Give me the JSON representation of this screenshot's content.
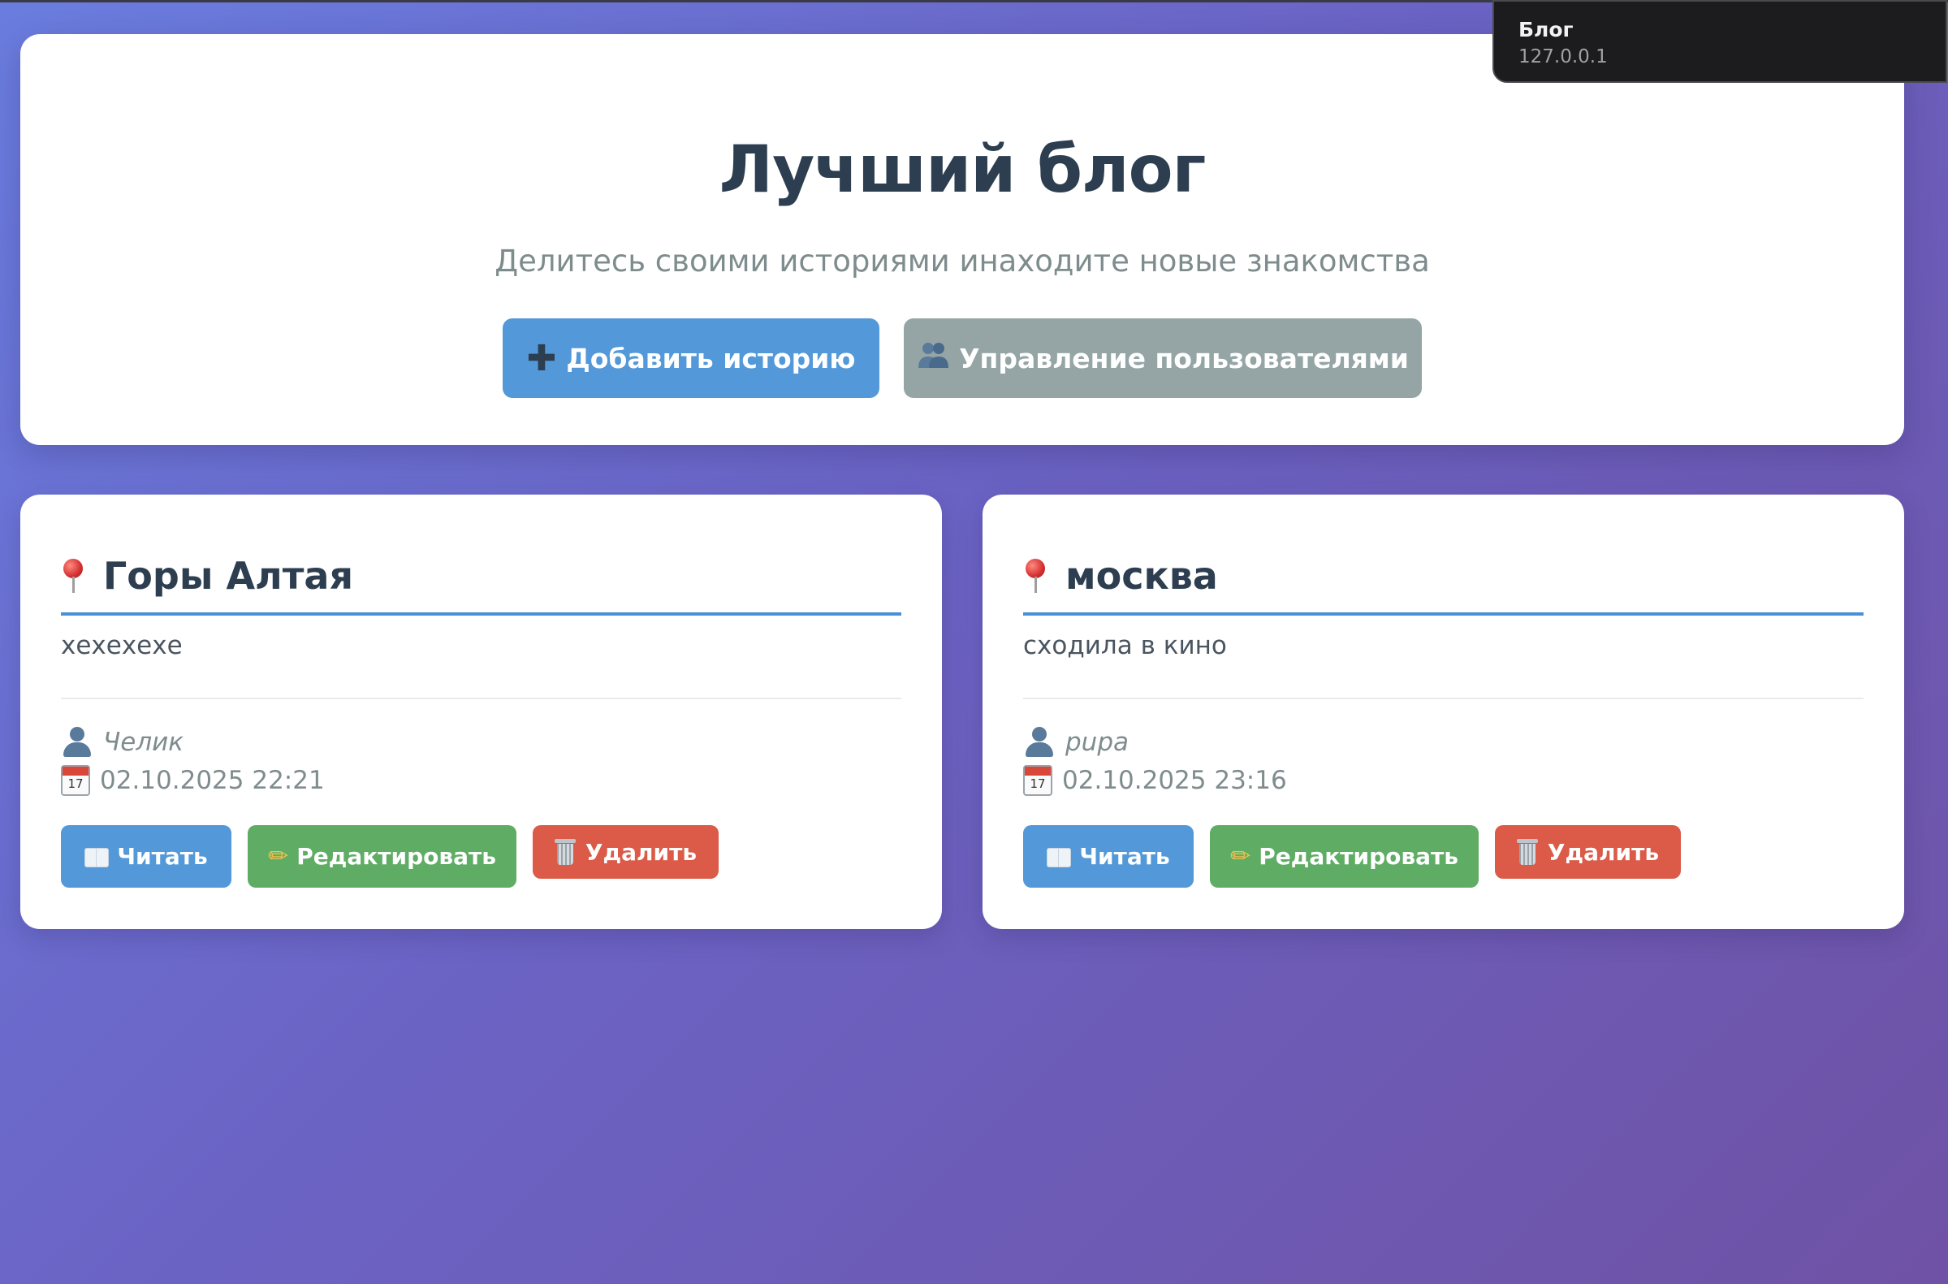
{
  "header": {
    "title": "Лучший блог",
    "subtitle": "Делитесь своими историями инаходите новые знакомства",
    "add_story_label": "Добавить историю",
    "manage_users_label": "Управление пользователями",
    "add_icon": "plus-icon",
    "users_icon": "users-icon"
  },
  "stories": [
    {
      "title": "Горы Алтая",
      "text": "хехехехе",
      "author": "Челик",
      "date": "02.10.2025 22:21",
      "calendar_day": "17",
      "read_label": "Читать",
      "edit_label": "Редактировать",
      "delete_label": "Удалить"
    },
    {
      "title": "москва",
      "text": "сходила в кино",
      "author": "pupa",
      "date": "02.10.2025 23:16",
      "calendar_day": "17",
      "read_label": "Читать",
      "edit_label": "Редактировать",
      "delete_label": "Удалить"
    }
  ],
  "tooltip": {
    "title": "Блог",
    "url": "127.0.0.1"
  },
  "colors": {
    "primary": "#5398d8",
    "secondary": "#95a5a6",
    "success": "#5fad65",
    "danger": "#dc5a48",
    "heading": "#2c3e50"
  }
}
